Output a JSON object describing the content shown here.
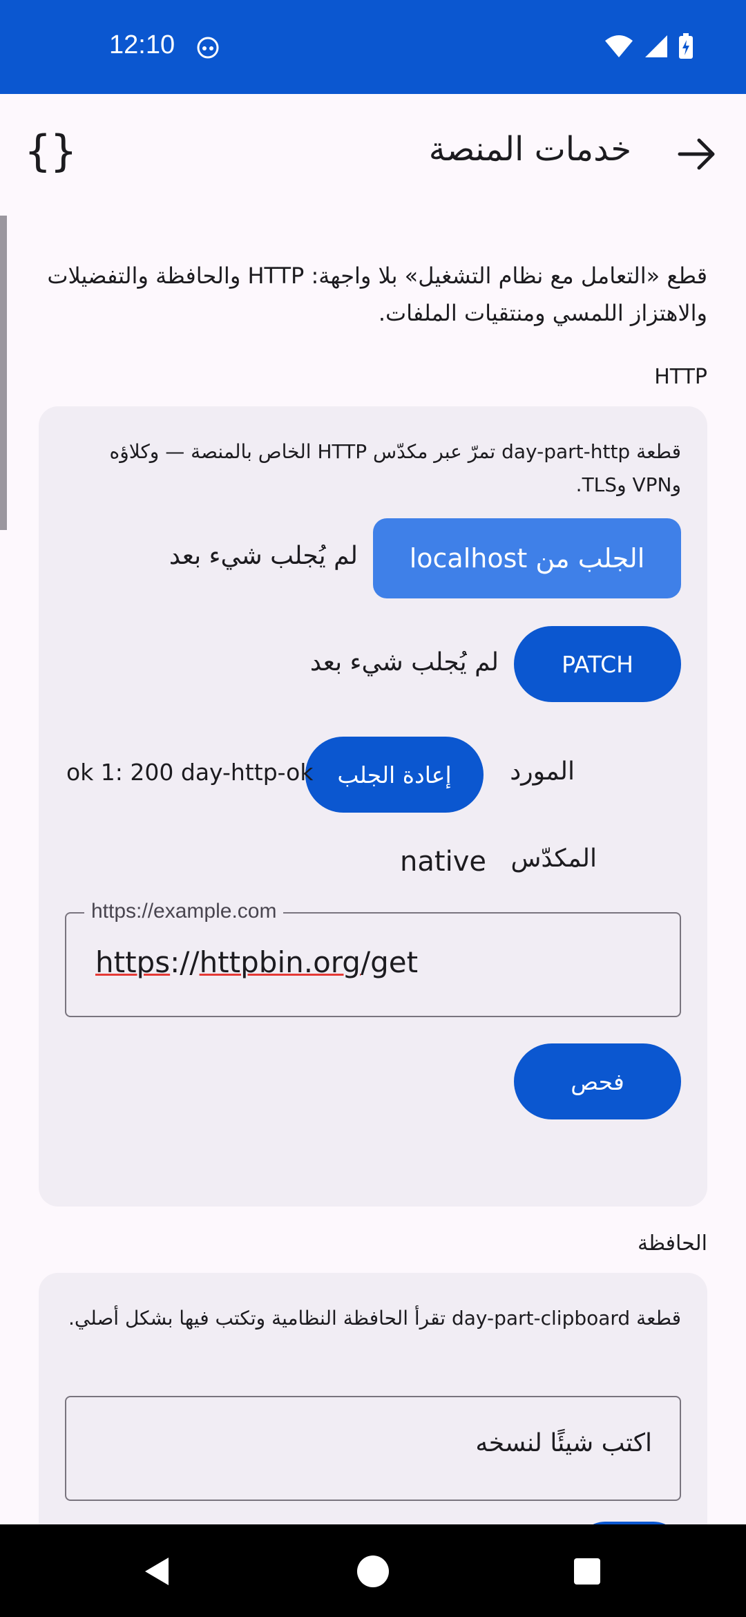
{
  "status_bar": {
    "time": "12:10",
    "icons": [
      "wifi-icon",
      "signal-icon",
      "battery-charging-icon"
    ],
    "color": "#0b57d0"
  },
  "app_bar": {
    "title": "خدمات المنصة",
    "back_icon": "arrow-forward-icon",
    "action_icon": "code-braces-icon",
    "action_glyph": "{}"
  },
  "intro": "قطع «التعامل مع نظام التشغيل» بلا واجهة: HTTP والحافظة والتفضيلات والاهتزاز اللمسي ومنتقيات الملفات.",
  "http_section": {
    "title": "HTTP",
    "description": "قطعة day-part-http تمرّ عبر مكدّس HTTP الخاص بالمنصة — وكلاؤه وVPN وTLS.",
    "localhost_button": "الجلب من localhost",
    "localhost_status": "لم يُجلب شيء بعد",
    "patch_button": "PATCH",
    "patch_status": "لم يُجلب شيء بعد",
    "resource_label": "المورد",
    "refetch_button": "إعادة الجلب",
    "resource_result": "ok 1: 200 day-http-ok",
    "stack_label": "المكدّس",
    "stack_value": "native",
    "url_field": {
      "label": "https://example.com",
      "value_part1": "https",
      "value_part2": "://",
      "value_part3": "httpbin.org",
      "value_part4": "/get"
    },
    "check_button": "فحص"
  },
  "clipboard_section": {
    "title": "الحافظة",
    "description": "قطعة day-part-clipboard تقرأ الحافظة النظامية وتكتب فيها بشكل أصلي.",
    "input_placeholder": "اكتب شيئًا لنسخه"
  },
  "colors": {
    "primary": "#0b57d0",
    "primary_light": "#3f80e8",
    "card": "#f1edf4",
    "background": "#fdf8fd"
  }
}
